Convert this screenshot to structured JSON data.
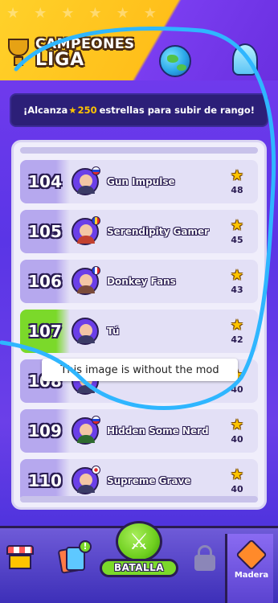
{
  "header": {
    "title_line1": "CAMPEONES",
    "title_line2": "LIGA"
  },
  "banner": {
    "prefix": "¡Alcanza",
    "stars_needed": "250",
    "suffix": "estrellas para subir de rango!"
  },
  "leaderboard": {
    "rows": [
      {
        "rank": "104",
        "name": "Gun Impulse",
        "stars": "48",
        "is_me": false
      },
      {
        "rank": "105",
        "name": "Serendipity Gamer",
        "stars": "45",
        "is_me": false
      },
      {
        "rank": "106",
        "name": "Donkey Fans",
        "stars": "43",
        "is_me": false
      },
      {
        "rank": "107",
        "name": "Tú",
        "stars": "42",
        "is_me": true
      },
      {
        "rank": "108",
        "name": "",
        "stars": "40",
        "is_me": false
      },
      {
        "rank": "109",
        "name": "Hidden Some Nerd",
        "stars": "40",
        "is_me": false
      },
      {
        "rank": "110",
        "name": "Supreme Grave",
        "stars": "40",
        "is_me": false
      }
    ]
  },
  "tooltip": {
    "text": "This image is without the mod"
  },
  "bottom_nav": {
    "battle_label": "BATALLA",
    "madera_label": "Madera",
    "cards_badge": "!"
  },
  "colors": {
    "accent_gold": "#ffc400",
    "me_row_green": "#7bd92a",
    "panel_bg": "#f0eefb",
    "annotation_blue": "#2fb6ff"
  }
}
